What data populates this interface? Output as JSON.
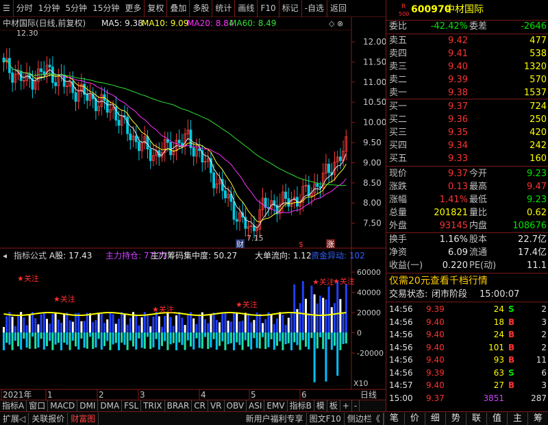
{
  "toolbar": {
    "tabs": [
      "分时",
      "1分钟",
      "5分钟",
      "15分钟",
      "更多",
      "复权",
      "叠加",
      "多股",
      "统计",
      "画线",
      "F10",
      "标记",
      "-自选",
      "返回"
    ]
  },
  "chart": {
    "title": "中材国际(日线,前复权)",
    "ma5": "MA5: 9.38",
    "ma10": "MA10: 9.09",
    "ma20": "MA20: 8.84",
    "ma60": "MA60: 8.49",
    "high_mark": "12.30",
    "low_mark": "7.15",
    "price_axis": [
      "12.00",
      "11.50",
      "11.00",
      "10.50",
      "10.00",
      "9.50",
      "9.00",
      "8.50",
      "8.00",
      "7.50"
    ],
    "event_labels": [
      "财",
      "$",
      "涨"
    ],
    "indicator_title": "指标公式",
    "indicator_items": [
      {
        "text": "A股: 17.43",
        "color": "#e8e8e8"
      },
      {
        "text": "主力持仓: 77.77",
        "color": "#cc44ff"
      },
      {
        "text": "主力筹码集中度: 50.27",
        "color": "#e8e8e8"
      },
      {
        "text": "大单流向: 1.12",
        "color": "#e8e8e8"
      },
      {
        "text": "资金异动: 102",
        "color": "#3060ff"
      }
    ],
    "vol_axis": [
      "60000",
      "40000",
      "20000",
      "0",
      "-20000"
    ],
    "x10": "X10",
    "star_label": "★关注",
    "months": [
      "2021年",
      "1",
      "2",
      "3",
      "4",
      "5",
      "6"
    ],
    "period": "日线"
  },
  "bottom_tabs": [
    "指标A",
    "窗口",
    "MACD",
    "DMI",
    "DMA",
    "FSL",
    "TRIX",
    "BRAR",
    "CR",
    "VR",
    "OBV",
    "ASI",
    "EMV",
    "指标B",
    "模",
    "板",
    "+",
    "-"
  ],
  "status_tabs": [
    "扩展◁",
    "关联报价",
    "财富图",
    "新用户福利专享",
    "图文F10",
    "侧边栏《"
  ],
  "status_right": [
    "笔",
    "价",
    "细",
    "势",
    "联",
    "值",
    "主",
    "筹"
  ],
  "quote": {
    "code": "600970",
    "name": "中材国际",
    "badge_top": "R",
    "badge_bottom": "500",
    "weibi_label": "委比",
    "weibi": "-42.42%",
    "weicha_label": "委差",
    "weicha": "-2646",
    "asks": [
      {
        "label": "卖五",
        "price": "9.42",
        "vol": "477"
      },
      {
        "label": "卖四",
        "price": "9.41",
        "vol": "538"
      },
      {
        "label": "卖三",
        "price": "9.40",
        "vol": "1320"
      },
      {
        "label": "卖二",
        "price": "9.39",
        "vol": "570"
      },
      {
        "label": "卖一",
        "price": "9.38",
        "vol": "1537"
      }
    ],
    "bids": [
      {
        "label": "买一",
        "price": "9.37",
        "vol": "724"
      },
      {
        "label": "买二",
        "price": "9.36",
        "vol": "250"
      },
      {
        "label": "买三",
        "price": "9.35",
        "vol": "420"
      },
      {
        "label": "买四",
        "price": "9.34",
        "vol": "242"
      },
      {
        "label": "买五",
        "price": "9.33",
        "vol": "160"
      }
    ],
    "stats": [
      {
        "l1": "现价",
        "v1": "9.37",
        "c1": "red",
        "l2": "今开",
        "v2": "9.23",
        "c2": "green"
      },
      {
        "l1": "涨跌",
        "v1": "0.13",
        "c1": "red",
        "l2": "最高",
        "v2": "9.47",
        "c2": "red"
      },
      {
        "l1": "涨幅",
        "v1": "1.41%",
        "c1": "red",
        "l2": "最低",
        "v2": "9.23",
        "c2": "green"
      },
      {
        "l1": "总量",
        "v1": "201821",
        "c1": "yellow",
        "l2": "量比",
        "v2": "0.62",
        "c2": "yellow"
      },
      {
        "l1": "外盘",
        "v1": "93145",
        "c1": "red",
        "l2": "内盘",
        "v2": "108676",
        "c2": "green"
      }
    ],
    "stats2": [
      {
        "l1": "换手",
        "v1": "1.16%",
        "l2": "股本",
        "v2": "22.7亿"
      },
      {
        "l1": "净资",
        "v1": "6.09",
        "l2": "流通",
        "v2": "17.4亿"
      },
      {
        "l1": "收益(一)",
        "v1": "0.220",
        "l2": "PE(动)",
        "v2": "11.1"
      }
    ],
    "promo": "仅需20元查看千档行情",
    "trade_state_label": "交易状态:",
    "trade_state": "闭市阶段",
    "trade_time": "15:00:07",
    "ticks": [
      {
        "t": "14:56",
        "p": "9.39",
        "v": "24",
        "bs": "S",
        "n": "2"
      },
      {
        "t": "14:56",
        "p": "9.40",
        "v": "18",
        "bs": "B",
        "n": "3"
      },
      {
        "t": "14:56",
        "p": "9.40",
        "v": "24",
        "bs": "B",
        "n": "2"
      },
      {
        "t": "14:56",
        "p": "9.40",
        "v": "101",
        "bs": "B",
        "n": "2"
      },
      {
        "t": "14:56",
        "p": "9.40",
        "v": "93",
        "bs": "B",
        "n": "11"
      },
      {
        "t": "14:56",
        "p": "9.39",
        "v": "63",
        "bs": "S",
        "n": "6"
      },
      {
        "t": "14:57",
        "p": "9.40",
        "v": "27",
        "bs": "B",
        "n": "3"
      },
      {
        "t": "15:00",
        "p": "9.37",
        "v": "3851",
        "bs": "",
        "n": "287"
      }
    ]
  }
}
